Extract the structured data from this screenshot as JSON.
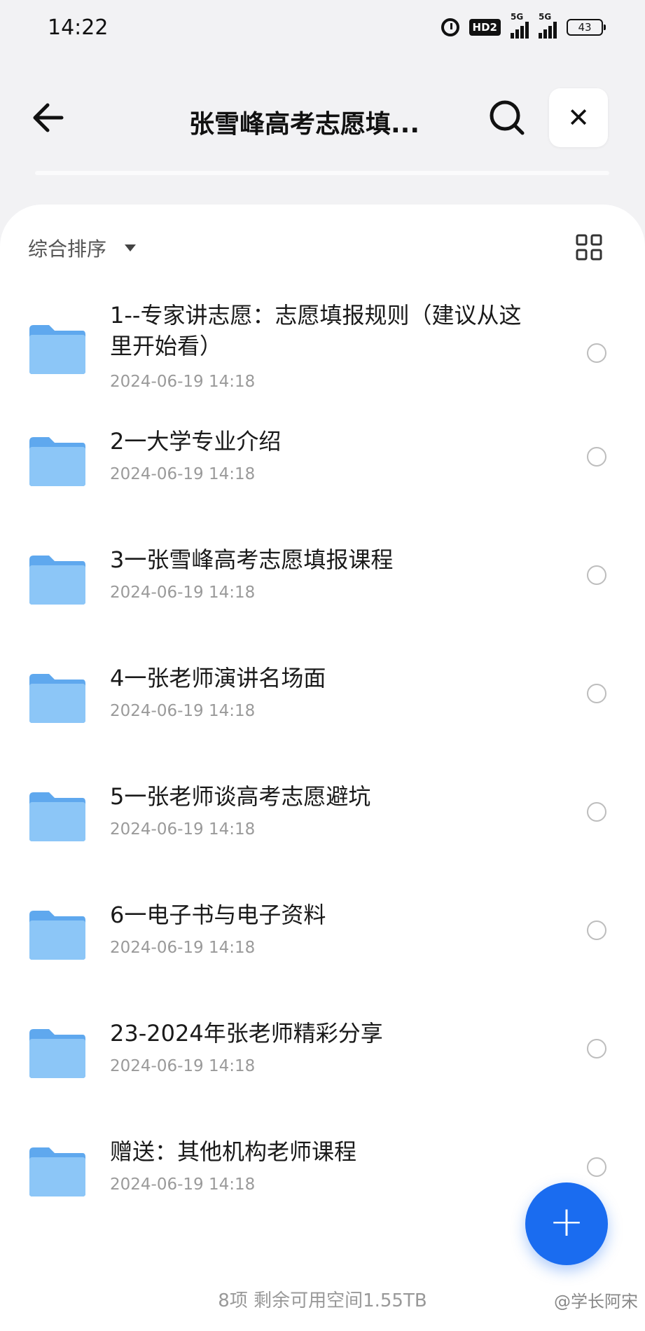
{
  "status_bar": {
    "time": "14:22",
    "hd_label": "HD2",
    "signal1_label": "5G",
    "signal2_label": "5G",
    "battery": "43"
  },
  "header": {
    "title": "张雪峰高考志愿填...",
    "back_icon": "arrow-left-icon",
    "search_icon": "search-icon",
    "close_symbol": "✕"
  },
  "toolbar": {
    "sort_label": "综合排序",
    "view_icon": "grid-view-icon"
  },
  "files": [
    {
      "name": "1--专家讲志愿：志愿填报规则（建议从这里开始看）",
      "date": "2024-06-19 14:18"
    },
    {
      "name": "2一大学专业介绍",
      "date": "2024-06-19 14:18"
    },
    {
      "name": "3一张雪峰高考志愿填报课程",
      "date": "2024-06-19 14:18"
    },
    {
      "name": "4一张老师演讲名场面",
      "date": "2024-06-19 14:18"
    },
    {
      "name": "5一张老师谈高考志愿避坑",
      "date": "2024-06-19 14:18"
    },
    {
      "name": "6一电子书与电子资料",
      "date": "2024-06-19 14:18"
    },
    {
      "name": "23-2024年张老师精彩分享",
      "date": "2024-06-19 14:18"
    },
    {
      "name": "赠送：其他机构老师课程",
      "date": "2024-06-19 14:18"
    }
  ],
  "footer": {
    "summary": "8项 剩余可用空间1.55TB"
  },
  "fab_symbol": "+",
  "watermark": "@学长阿宋",
  "colors": {
    "accent": "#1a6cf0",
    "folder": "#6fb3f2"
  }
}
